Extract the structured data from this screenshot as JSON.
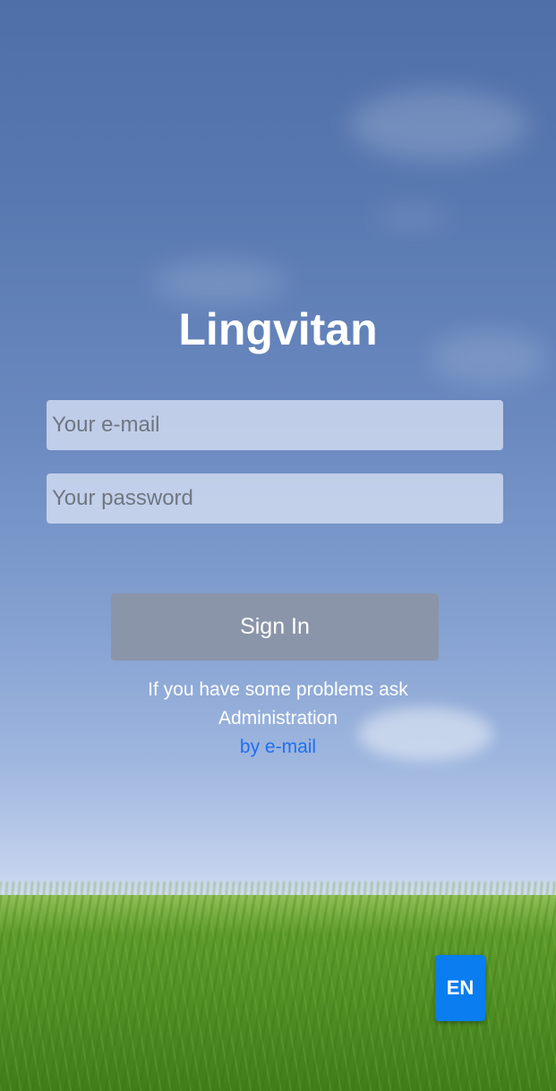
{
  "app": {
    "title": "Lingvitan"
  },
  "login": {
    "email_placeholder": "Your e-mail",
    "email_value": "",
    "password_placeholder": "Your password",
    "password_value": "",
    "signin_label": "Sign In"
  },
  "help": {
    "line1": "If you have some problems ask",
    "line2": "Administration",
    "link": "by e-mail"
  },
  "language": {
    "label": "EN"
  },
  "colors": {
    "link": "#1f6ff0",
    "lang_button": "#0a7df0",
    "signin_button": "#8a95a9"
  }
}
